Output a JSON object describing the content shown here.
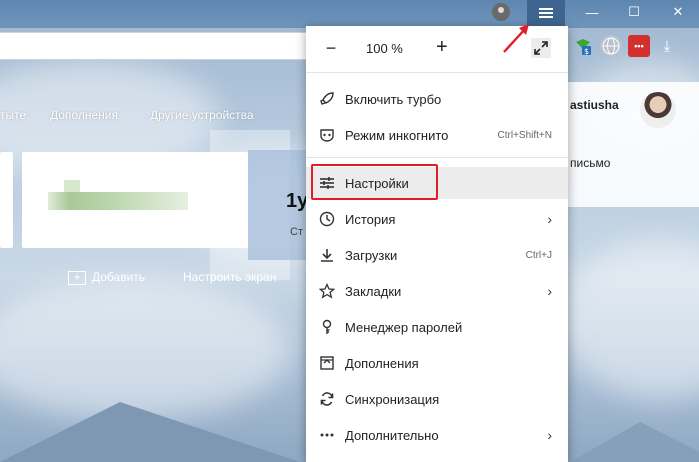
{
  "window": {
    "minimize_glyph": "—",
    "maximize_glyph": "☐",
    "close_glyph": "✕"
  },
  "topnav": {
    "items": [
      "тыте",
      "Дополнения",
      "Другие устройства"
    ]
  },
  "tiles": {
    "partial_text": "1у",
    "partial_sub": "Ст",
    "add_label": "Добавить",
    "customize_label": "Настроить экран"
  },
  "user": {
    "name": "astiusha",
    "mail_label": "письмо"
  },
  "menu": {
    "zoom": {
      "minus": "−",
      "value": "100 %",
      "plus": "+"
    },
    "items": [
      {
        "label": "Включить турбо",
        "icon": "rocket-icon"
      },
      {
        "label": "Режим инкогнито",
        "icon": "incognito-icon",
        "shortcut": "Ctrl+Shift+N"
      },
      {
        "label": "Настройки",
        "icon": "settings-sliders-icon"
      },
      {
        "label": "История",
        "icon": "clock-icon",
        "chevron": "›"
      },
      {
        "label": "Загрузки",
        "icon": "download-icon",
        "shortcut": "Ctrl+J"
      },
      {
        "label": "Закладки",
        "icon": "star-icon",
        "chevron": "›"
      },
      {
        "label": "Менеджер паролей",
        "icon": "key-icon"
      },
      {
        "label": "Дополнения",
        "icon": "extensions-icon"
      },
      {
        "label": "Синхронизация",
        "icon": "sync-icon"
      },
      {
        "label": "Дополнительно",
        "icon": "more-dots-icon",
        "chevron": "›"
      }
    ]
  },
  "colors": {
    "highlight_box": "#e11d2a",
    "arrow": "#e11d2a",
    "menu_button_bg": "#3e6590"
  }
}
